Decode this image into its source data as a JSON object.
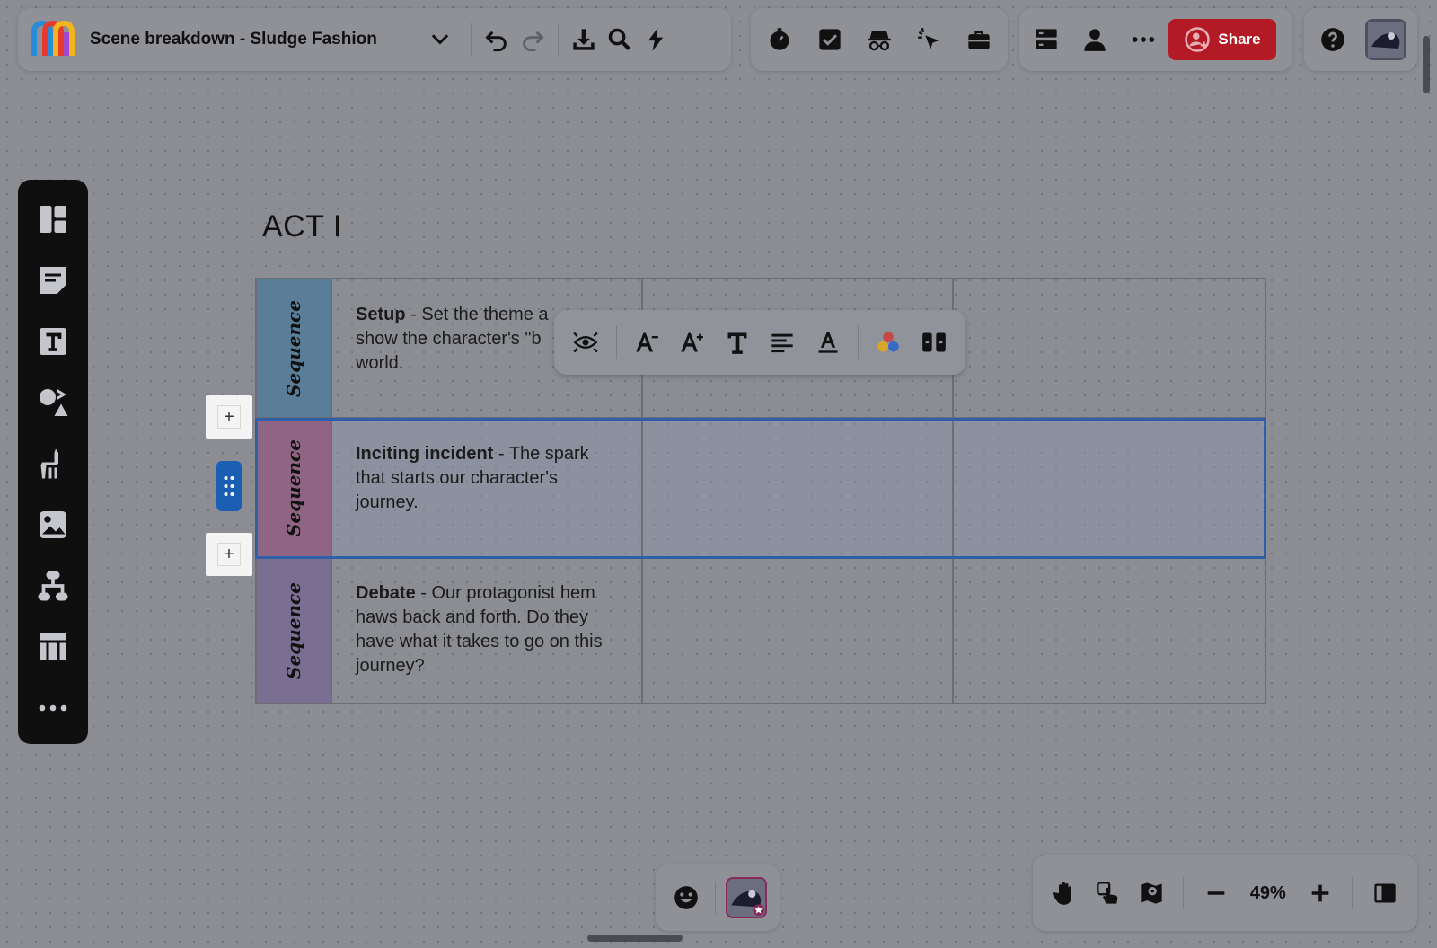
{
  "header": {
    "board_title": "Scene breakdown - Sludge Fashion",
    "share_label": "Share"
  },
  "canvas": {
    "act_title": "ACT I",
    "rows": [
      {
        "sequence_label": "Sequence",
        "color": "#5a7e98",
        "title": "Setup",
        "text": " - Set the theme a",
        "text_lines": [
          "show the character's \"b",
          "world."
        ]
      },
      {
        "sequence_label": "Sequence",
        "color": "#8f6583",
        "title": "Inciting incident",
        "text": " - The spark that starts our character's journey."
      },
      {
        "sequence_label": "Sequence",
        "color": "#7a6e92",
        "title": "Debate",
        "text": " - Our protagonist hem haws back and forth. Do they have what it takes to go on this journey?"
      }
    ]
  },
  "zoom": {
    "level": "49%"
  },
  "colors": {
    "share": "#b31a25",
    "selection": "#2f5fa8",
    "drag_handle": "#1a5fb4"
  }
}
